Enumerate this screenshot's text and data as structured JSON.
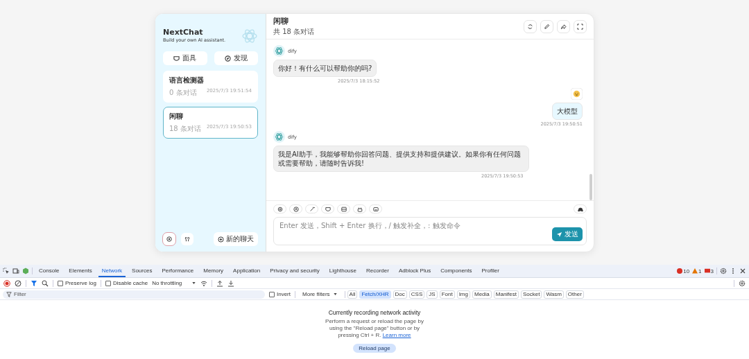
{
  "sidebar": {
    "title": "NextChat",
    "subtitle": "Build your own AI assistant.",
    "buttons": [
      {
        "kind": "mask",
        "label": "面具"
      },
      {
        "kind": "discover",
        "label": "发现"
      }
    ],
    "sessions": [
      {
        "title": "语言检测器",
        "count": "0 条对话",
        "time": "2025/7/3 19:51:54",
        "selected": false
      },
      {
        "title": "闲聊",
        "count": "18 条对话",
        "time": "2025/7/3 19:50:53",
        "selected": true
      }
    ],
    "new_chat": "新的聊天"
  },
  "chat": {
    "title": "闲聊",
    "subtitle": "共 18 条对话",
    "messages": [
      {
        "kind": "bot",
        "name": "dify",
        "text": "你好！有什么可以帮助你的吗?",
        "time": "2025/7/3 18:15:52"
      },
      {
        "kind": "user",
        "text": "大模型",
        "time": "2025/7/3 19:50:51"
      },
      {
        "kind": "bot",
        "name": "dify",
        "text": "我是AI助手，我能够帮助你回答问题、提供支持和提供建议。如果你有任何问题或需要帮助，请随时告诉我!",
        "time": "2025/7/3 19:50:53"
      }
    ],
    "input": {
      "placeholder": "Enter 发送，Shift + Enter 换行，/ 触发补全，: 触发命令"
    },
    "send": "发送"
  },
  "devtools": {
    "tabs": [
      {
        "label": "Console",
        "selected": false
      },
      {
        "label": "Elements",
        "selected": false
      },
      {
        "label": "Network",
        "selected": true
      },
      {
        "label": "Sources",
        "selected": false
      },
      {
        "label": "Performance",
        "selected": false
      },
      {
        "label": "Memory",
        "selected": false
      },
      {
        "label": "Application",
        "selected": false
      },
      {
        "label": "Privacy and security",
        "selected": false
      },
      {
        "label": "Lighthouse",
        "selected": false
      },
      {
        "label": "Recorder",
        "selected": false
      },
      {
        "label": "Adblock Plus",
        "selected": false
      },
      {
        "label": "Components",
        "selected": false
      },
      {
        "label": "Profiler",
        "selected": false
      }
    ],
    "issues": [
      {
        "kind": "error",
        "count": "10"
      },
      {
        "kind": "warning",
        "count": "1"
      },
      {
        "kind": "info",
        "count": "3"
      }
    ],
    "preserve_log": {
      "label": "Preserve log",
      "checked": false
    },
    "disable_cache": {
      "label": "Disable cache",
      "checked": false
    },
    "throttling": "No throttling",
    "filter": {
      "placeholder": "Filter"
    },
    "invert": {
      "label": "Invert",
      "checked": false
    },
    "more_filters": "More filters",
    "types": [
      {
        "label": "All",
        "selected": false
      },
      {
        "label": "Fetch/XHR",
        "selected": true
      },
      {
        "label": "Doc",
        "selected": false
      },
      {
        "label": "CSS",
        "selected": false
      },
      {
        "label": "JS",
        "selected": false
      },
      {
        "label": "Font",
        "selected": false
      },
      {
        "label": "Img",
        "selected": false
      },
      {
        "label": "Media",
        "selected": false
      },
      {
        "label": "Manifest",
        "selected": false
      },
      {
        "label": "Socket",
        "selected": false
      },
      {
        "label": "Wasm",
        "selected": false
      },
      {
        "label": "Other",
        "selected": false
      }
    ],
    "empty": {
      "title": "Currently recording network activity",
      "text": "Perform a request or reload the page by using the \"Reload page\" button or by pressing Ctrl + R.",
      "link": "Learn more",
      "button": "Reload page"
    }
  }
}
